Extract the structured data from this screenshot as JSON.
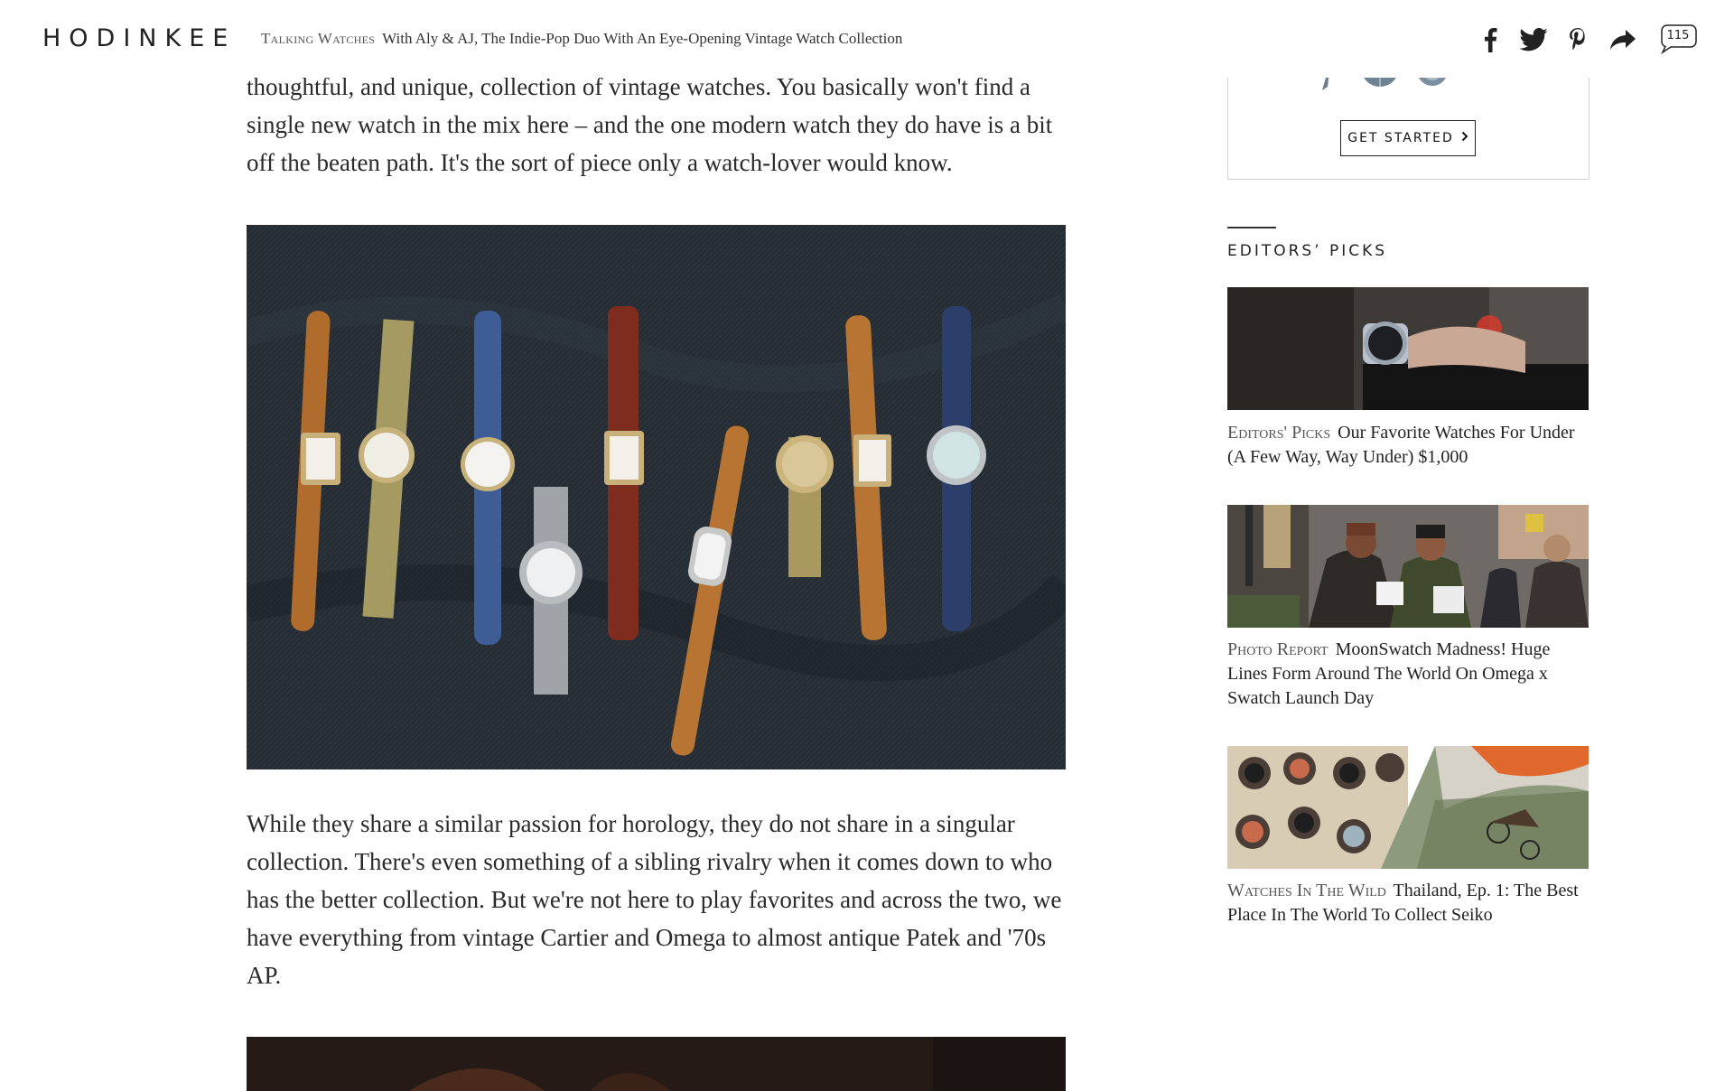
{
  "header": {
    "logo": "HODINKEE",
    "breadcrumb_category": "Talking Watches",
    "breadcrumb_title": "With Aly & AJ, The Indie-Pop Duo With An Eye-Opening Vintage Watch Collection",
    "share_icons": [
      "facebook-icon",
      "twitter-icon",
      "pinterest-icon",
      "share-arrow-icon"
    ],
    "comment_count": "115"
  },
  "article": {
    "paragraph_1": "thoughtful, and unique, collection of vintage watches. You basically won't find a single new watch in the mix here – and the one modern watch they do have is a bit off the beaten path. It's the sort of piece only a watch-lover would know.",
    "paragraph_2": "While they share a similar passion for horology, they do not share in a singular collection. There's even something of a sibling rivalry when it comes down to who has the better collection. But we're not here to play favorites and across the two, we have everything from vintage Cartier and Omega to almost antique Patek and '70s AP."
  },
  "sidebar": {
    "promo_button": "GET STARTED",
    "editors_picks_title": "EDITORS’ PICKS",
    "picks": [
      {
        "category": "Editors' Picks",
        "title": "Our Favorite Watches For Under (A Few Way, Way Under) $1,000"
      },
      {
        "category": "Photo Report",
        "title": "MoonSwatch Madness! Huge Lines Form Around The World On Omega x Swatch Launch Day"
      },
      {
        "category": "Watches In The Wild",
        "title": "Thailand, Ep. 1: The Best Place In The World To Collect Seiko"
      }
    ]
  },
  "colors": {
    "text": "#2a2a2a",
    "category_text": "#555555",
    "hero_background": "#232a31"
  }
}
